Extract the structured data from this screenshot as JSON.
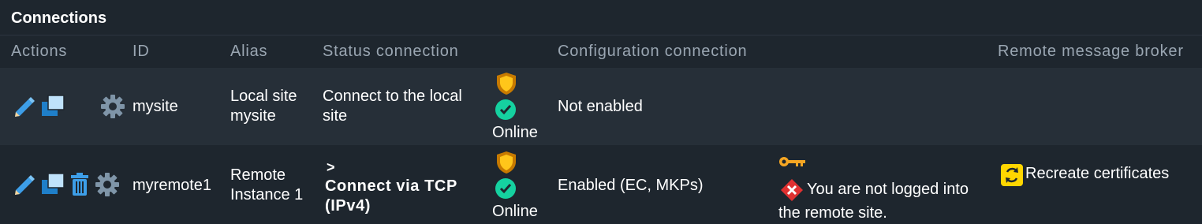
{
  "title": "Connections",
  "columns": {
    "actions": "Actions",
    "id": "ID",
    "alias": "Alias",
    "status": "Status connection",
    "config": "Configuration connection",
    "broker": "Remote message broker"
  },
  "rows": [
    {
      "id": "mysite",
      "alias_line1": "Local site",
      "alias_line2": "mysite",
      "status_line1": "Connect to the local",
      "status_line2": "site",
      "state": "Online",
      "config": "Not enabled"
    },
    {
      "id": "myremote1",
      "alias_line1": "Remote",
      "alias_line2": "Instance 1",
      "status_prefix": ">",
      "status_line1": "Connect via TCP",
      "status_line2": "(IPv4)",
      "state": "Online",
      "config": "Enabled (EC, MKPs)",
      "login_msg_line1": "You are not logged into",
      "login_msg_line2": "the remote site.",
      "broker_action": "Recreate certificates"
    }
  ],
  "icons": [
    "edit-icon",
    "clone-icon",
    "delete-icon",
    "gear-icon",
    "shield-icon",
    "check-icon",
    "key-icon",
    "error-icon",
    "refresh-icon"
  ],
  "colors": {
    "background": "#1e262e",
    "row_alt": "#262f38",
    "header_text": "#9aa6b2",
    "online_green": "#15d1a0",
    "shield_orange": "#f5a623",
    "error_red": "#e03131",
    "broker_yellow": "#ffd600"
  }
}
